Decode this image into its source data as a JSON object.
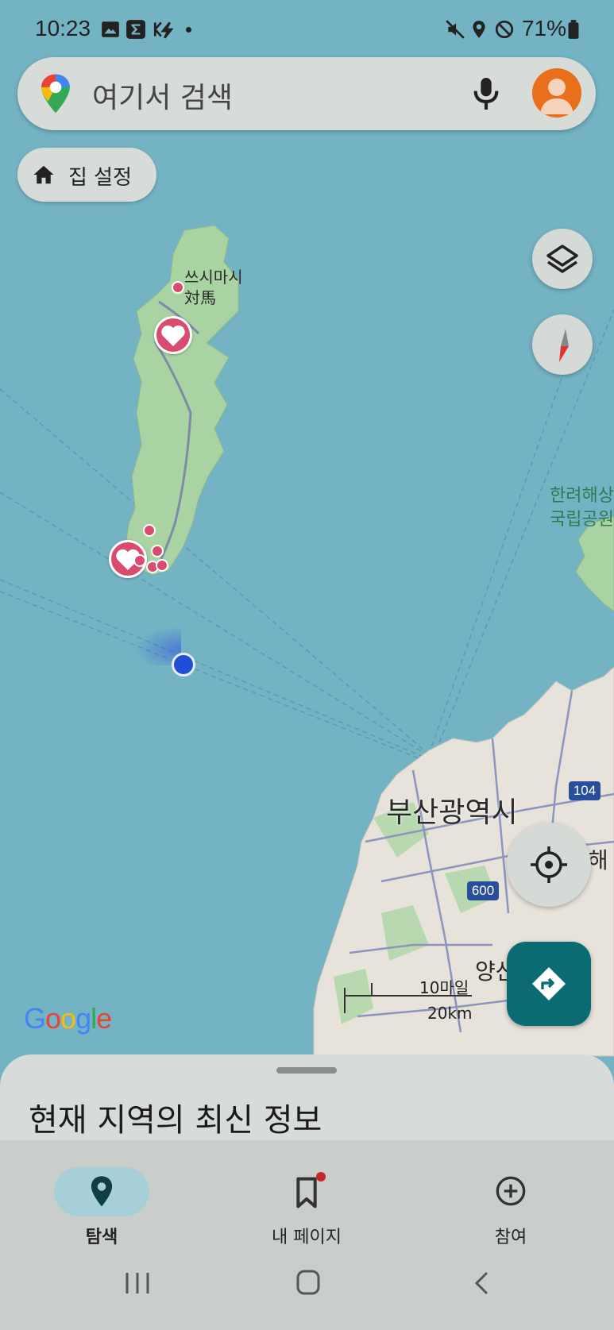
{
  "status_bar": {
    "time": "10:23",
    "battery": "71%"
  },
  "search": {
    "placeholder": "여기서 검색"
  },
  "home_chip": {
    "label": "집 설정"
  },
  "map": {
    "labels": {
      "tsushima_ko": "쓰시마시",
      "tsushima_ja": "対馬",
      "busan": "부산광역시",
      "hallyeo_1": "한려해상",
      "hallyeo_2": "국립공원",
      "haeun": "해",
      "yangsan": "양산",
      "route_104": "104",
      "route_600": "600"
    },
    "scale": {
      "miles": "10마일",
      "km": "20km"
    },
    "google_logo": "Google"
  },
  "sheet": {
    "title": "현재 지역의 최신 정보"
  },
  "bottom_nav": {
    "items": [
      {
        "label": "탐색"
      },
      {
        "label": "내 페이지"
      },
      {
        "label": "참여"
      }
    ]
  }
}
